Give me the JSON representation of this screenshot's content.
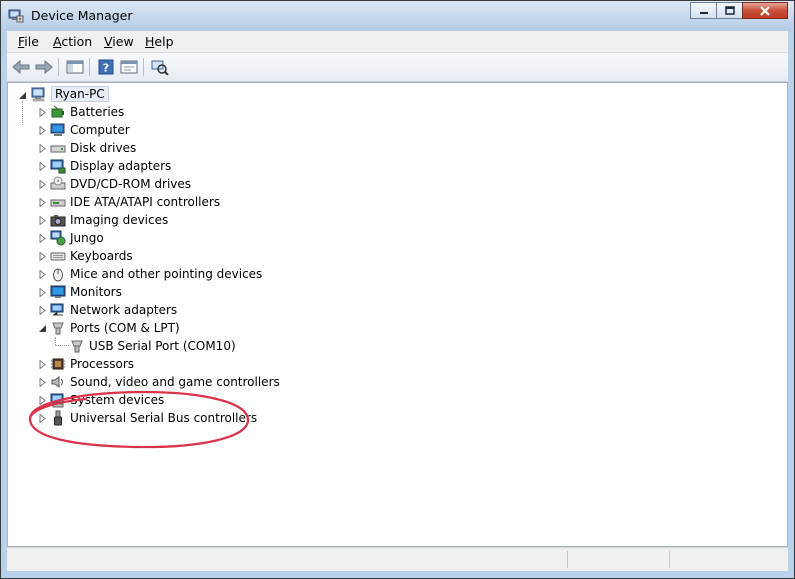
{
  "window": {
    "title": "Device Manager",
    "accent": "#b9d1ea",
    "close_color": "#c7503a"
  },
  "menu": {
    "items": [
      {
        "label": "File",
        "accel": "F",
        "rest": "ile"
      },
      {
        "label": "Action",
        "accel": "A",
        "rest": "ction"
      },
      {
        "label": "View",
        "accel": "V",
        "rest": "iew"
      },
      {
        "label": "Help",
        "accel": "H",
        "rest": "elp"
      }
    ]
  },
  "toolbar": {
    "icons": [
      "back-arrow-icon",
      "forward-arrow-icon",
      "show-hide-console-tree-icon",
      "help-icon",
      "properties-icon",
      "scan-hardware-changes-icon"
    ]
  },
  "tree": {
    "root": "Ryan-PC",
    "categories": [
      {
        "label": "Batteries",
        "icon": "battery-icon",
        "expanded": false
      },
      {
        "label": "Computer",
        "icon": "computer-icon",
        "expanded": false
      },
      {
        "label": "Disk drives",
        "icon": "disk-drive-icon",
        "expanded": false
      },
      {
        "label": "Display adapters",
        "icon": "display-adapter-icon",
        "expanded": false
      },
      {
        "label": "DVD/CD-ROM drives",
        "icon": "dvd-drive-icon",
        "expanded": false
      },
      {
        "label": "IDE ATA/ATAPI controllers",
        "icon": "ide-controller-icon",
        "expanded": false
      },
      {
        "label": "Imaging devices",
        "icon": "camera-icon",
        "expanded": false
      },
      {
        "label": "Jungo",
        "icon": "jungo-icon",
        "expanded": false
      },
      {
        "label": "Keyboards",
        "icon": "keyboard-icon",
        "expanded": false
      },
      {
        "label": "Mice and other pointing devices",
        "icon": "mouse-icon",
        "expanded": false
      },
      {
        "label": "Monitors",
        "icon": "monitor-icon",
        "expanded": false
      },
      {
        "label": "Network adapters",
        "icon": "network-adapter-icon",
        "expanded": false
      },
      {
        "label": "Ports (COM & LPT)",
        "icon": "port-icon",
        "expanded": true,
        "children": [
          "USB Serial Port (COM10)"
        ]
      },
      {
        "label": "Processors",
        "icon": "processor-icon",
        "expanded": false
      },
      {
        "label": "Sound, video and game controllers",
        "icon": "speaker-icon",
        "expanded": false
      },
      {
        "label": "System devices",
        "icon": "system-device-icon",
        "expanded": false
      },
      {
        "label": "Universal Serial Bus controllers",
        "icon": "usb-icon",
        "expanded": false
      }
    ]
  },
  "annotation": {
    "color": "#d9344a"
  }
}
